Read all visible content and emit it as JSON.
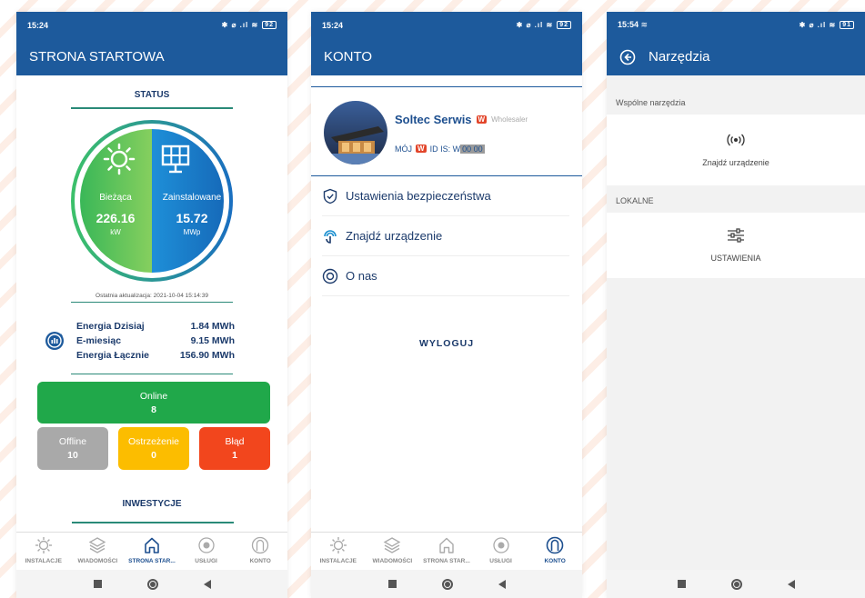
{
  "colors": {
    "brand": "#1d5a9c",
    "accent": "#2a8a78",
    "online": "#20a84a",
    "offline": "#a9a9a9",
    "warning": "#fcbd00",
    "error": "#f2461d"
  },
  "screen1": {
    "time": "15:24",
    "battery": "92",
    "title": "STRONA STARTOWA",
    "status_title": "STATUS",
    "current_label": "Bieżąca",
    "current_value": "226.16",
    "current_unit": "kW",
    "installed_label": "Zainstalowane",
    "installed_value": "15.72",
    "installed_unit": "MWp",
    "last_update": "Ostatnia aktualizacja: 2021-10-04 15:14:39",
    "energy": [
      {
        "label": "Energia Dzisiaj",
        "value": "1.84 MWh"
      },
      {
        "label": "E-miesiąc",
        "value": "9.15 MWh"
      },
      {
        "label": "Energia Łącznie",
        "value": "156.90 MWh"
      }
    ],
    "tiles": {
      "online_label": "Online",
      "online_value": "8",
      "offline_label": "Offline",
      "offline_value": "10",
      "warning_label": "Ostrzeżenie",
      "warning_value": "0",
      "error_label": "Błąd",
      "error_value": "1"
    },
    "invest_title": "INWESTYCJE"
  },
  "nav": {
    "installs": "INSTALACJE",
    "messages": "WIADOMOŚCI",
    "home": "STRONA STAR...",
    "services": "USŁUGI",
    "account": "KONTO"
  },
  "screen2": {
    "time": "15:24",
    "battery": "92",
    "title": "KONTO",
    "name": "Soltec Serwis",
    "badge": "W",
    "role": "Wholesaler",
    "id_prefix": "MÓJ",
    "id_label": "ID IS: W",
    "id_selected": "00 00",
    "menu": [
      "Ustawienia bezpieczeństwa",
      "Znajdź urządzenie",
      "O nas"
    ],
    "logout": "WYLOGUJ"
  },
  "screen3": {
    "time": "15:54",
    "battery": "91",
    "title": "Narzędzia",
    "common_tools": "Wspólne narzędzia",
    "find_device": "Znajdź urządzenie",
    "local": "LOKALNE",
    "settings": "USTAWIENIA"
  }
}
